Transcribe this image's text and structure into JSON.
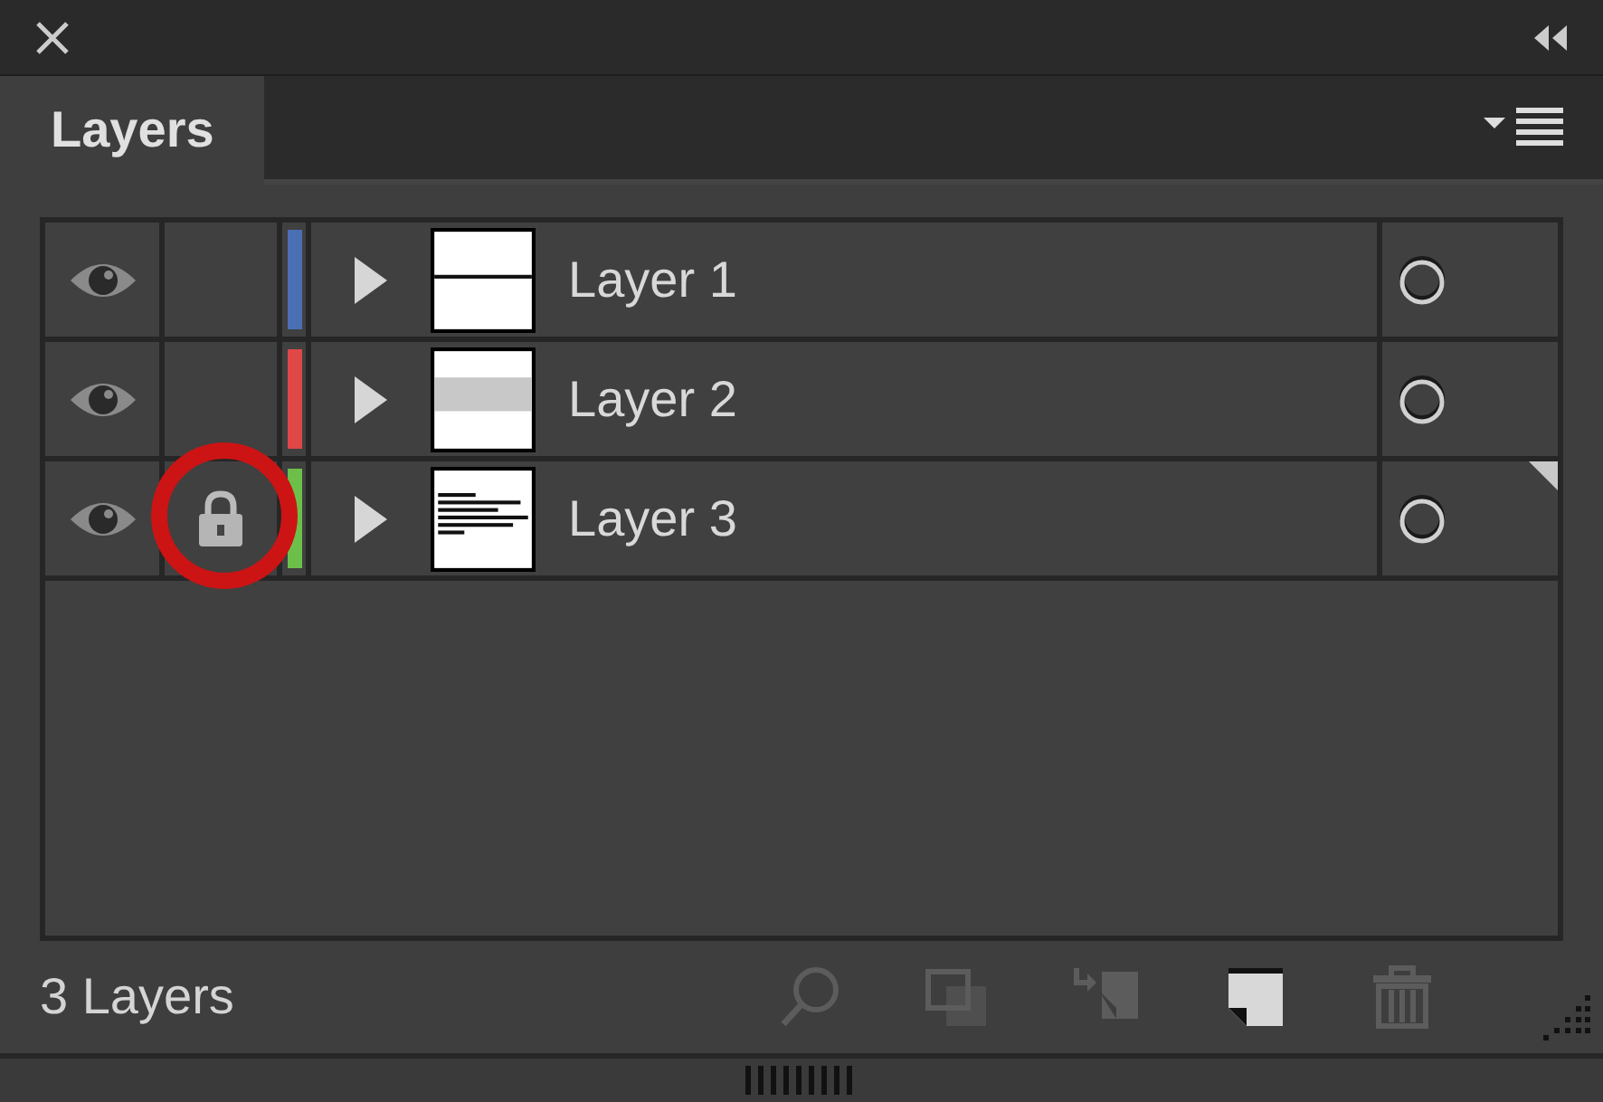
{
  "panel": {
    "tab": {
      "label": "Layers",
      "selected": true
    }
  },
  "layers": [
    {
      "name": "Layer 1",
      "visible": true,
      "locked": false,
      "color": "#4a6fb5",
      "kind": "line",
      "active": false,
      "circled": false
    },
    {
      "name": "Layer 2",
      "visible": true,
      "locked": false,
      "color": "#e04848",
      "kind": "band",
      "active": false,
      "circled": false
    },
    {
      "name": "Layer 3",
      "visible": true,
      "locked": true,
      "color": "#6cc04a",
      "kind": "text",
      "active": true,
      "circled": true
    }
  ],
  "footer": {
    "count": "3 Layers",
    "buttons": [
      {
        "kind": "locate",
        "disabled": true
      },
      {
        "kind": "clip",
        "disabled": true
      },
      {
        "kind": "move",
        "disabled": true
      },
      {
        "kind": "new",
        "disabled": false
      },
      {
        "kind": "delete",
        "disabled": true
      }
    ]
  }
}
